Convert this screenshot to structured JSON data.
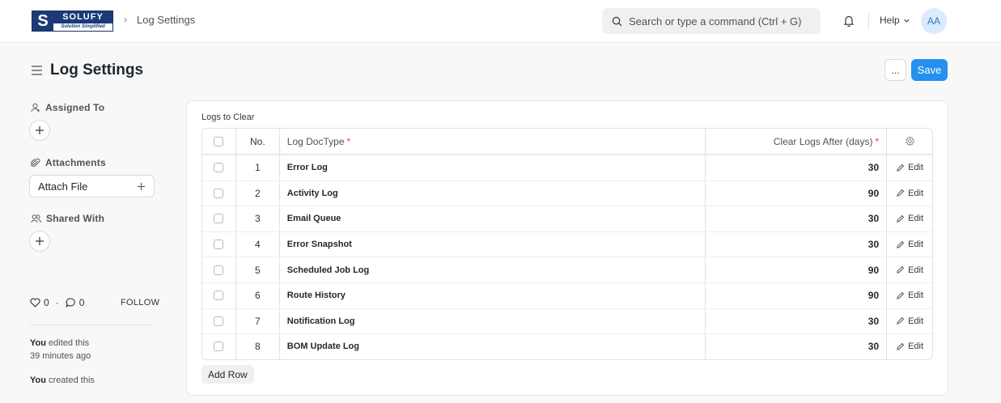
{
  "navbar": {
    "brand_word": "SOLUFY",
    "brand_tagline": "Solution Simplified",
    "brand_mark": "S",
    "breadcrumb": "Log Settings",
    "search_placeholder": "Search or type a command (Ctrl + G)",
    "help_label": "Help",
    "avatar_initials": "AA"
  },
  "page": {
    "title": "Log Settings",
    "more_label": "...",
    "save_label": "Save"
  },
  "sidebar": {
    "assigned_to": "Assigned To",
    "attachments": "Attachments",
    "attach_file": "Attach File",
    "shared_with": "Shared With",
    "likes": "0",
    "comments": "0",
    "stats_separator": "·",
    "follow": "FOLLOW",
    "activity": [
      {
        "actor": "You",
        "text": " edited this",
        "time": "39 minutes ago"
      },
      {
        "actor": "You",
        "text": " created this",
        "time": ""
      }
    ]
  },
  "table": {
    "section_label": "Logs to Clear",
    "headers": {
      "no": "No.",
      "doctype": "Log DocType",
      "days": "Clear Logs After (days)",
      "required_mark": "*"
    },
    "edit_label": "Edit",
    "rows": [
      {
        "no": "1",
        "doctype": "Error Log",
        "days": "30"
      },
      {
        "no": "2",
        "doctype": "Activity Log",
        "days": "90"
      },
      {
        "no": "3",
        "doctype": "Email Queue",
        "days": "30"
      },
      {
        "no": "4",
        "doctype": "Error Snapshot",
        "days": "30"
      },
      {
        "no": "5",
        "doctype": "Scheduled Job Log",
        "days": "90"
      },
      {
        "no": "6",
        "doctype": "Route History",
        "days": "90"
      },
      {
        "no": "7",
        "doctype": "Notification Log",
        "days": "30"
      },
      {
        "no": "8",
        "doctype": "BOM Update Log",
        "days": "30"
      }
    ],
    "add_row": "Add Row"
  },
  "colors": {
    "primary": "#2490ef",
    "required": "#e24c4c",
    "brand": "#1b3a78"
  }
}
